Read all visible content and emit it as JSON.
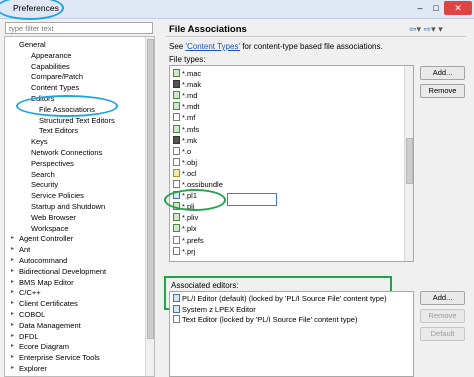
{
  "window": {
    "title": "Preferences",
    "controls": [
      "–",
      "□",
      "✕"
    ]
  },
  "sidebar": {
    "filter_placeholder": "type filter text",
    "items": [
      {
        "label": "General",
        "level": 0
      },
      {
        "label": "Appearance",
        "level": 1
      },
      {
        "label": "Capabilities",
        "level": 1
      },
      {
        "label": "Compare/Patch",
        "level": 1
      },
      {
        "label": "Content Types",
        "level": 1
      },
      {
        "label": "Editors",
        "level": 1
      },
      {
        "label": "File Associations",
        "level": 2
      },
      {
        "label": "Structured Text Editors",
        "level": 2
      },
      {
        "label": "Text Editors",
        "level": 2
      },
      {
        "label": "Keys",
        "level": 1
      },
      {
        "label": "Network Connections",
        "level": 1
      },
      {
        "label": "Perspectives",
        "level": 1
      },
      {
        "label": "Search",
        "level": 1
      },
      {
        "label": "Security",
        "level": 1
      },
      {
        "label": "Service Policies",
        "level": 1
      },
      {
        "label": "Startup and Shutdown",
        "level": 1
      },
      {
        "label": "Web Browser",
        "level": 1
      },
      {
        "label": "Workspace",
        "level": 1
      },
      {
        "label": "Agent Controller",
        "level": 0
      },
      {
        "label": "Ant",
        "level": 0
      },
      {
        "label": "Autocommand",
        "level": 0
      },
      {
        "label": "Bidirectional Development",
        "level": 0
      },
      {
        "label": "BMS Map Editor",
        "level": 0
      },
      {
        "label": "C/C++",
        "level": 0
      },
      {
        "label": "Client Certificates",
        "level": 0
      },
      {
        "label": "COBOL",
        "level": 0
      },
      {
        "label": "Data Management",
        "level": 0
      },
      {
        "label": "DFDL",
        "level": 0
      },
      {
        "label": "Ecore Diagram",
        "level": 0
      },
      {
        "label": "Enterprise Service Tools",
        "level": 0
      },
      {
        "label": "Explorer",
        "level": 0
      }
    ]
  },
  "main": {
    "title": "File Associations",
    "desc_prefix": "See ",
    "desc_link": "'Content Types'",
    "desc_suffix": " for content-type based file associations.",
    "file_types_label": "File types:",
    "file_types": [
      {
        "label": "*.mac",
        "icon": "green"
      },
      {
        "label": "*.mak",
        "icon": "dark"
      },
      {
        "label": "*.md",
        "icon": "green"
      },
      {
        "label": "*.mdt",
        "icon": "green"
      },
      {
        "label": "*.mf",
        "icon": "plain"
      },
      {
        "label": "*.mfs",
        "icon": "green"
      },
      {
        "label": "*.mk",
        "icon": "dark"
      },
      {
        "label": "*.o",
        "icon": "plain"
      },
      {
        "label": "*.obj",
        "icon": "plain"
      },
      {
        "label": "*.ocl",
        "icon": "yellow"
      },
      {
        "label": "*.ossibundle",
        "icon": "plain"
      },
      {
        "label": "*.pl1",
        "icon": "blue"
      },
      {
        "label": "*.pli",
        "icon": "green"
      },
      {
        "label": "*.pliv",
        "icon": "green"
      },
      {
        "label": "*.plx",
        "icon": "green"
      },
      {
        "label": "*.prefs",
        "icon": "plain"
      },
      {
        "label": "*.prj",
        "icon": "plain"
      }
    ],
    "assoc_label": "Associated editors:",
    "assoc_editors": [
      {
        "label": "PL/I Editor (default) (locked by 'PL/I Source File' content type)"
      },
      {
        "label": "System z LPEX Editor"
      },
      {
        "label": "Text Editor (locked by 'PL/I Source File' content type)"
      }
    ],
    "buttons": {
      "add": "Add...",
      "remove": "Remove",
      "add2": "Add...",
      "remove2": "Remove",
      "default": "Default"
    }
  },
  "colors": {
    "annotation_blue": "#1ea4de",
    "annotation_green": "#22a24a",
    "link": "#1a55b8"
  }
}
